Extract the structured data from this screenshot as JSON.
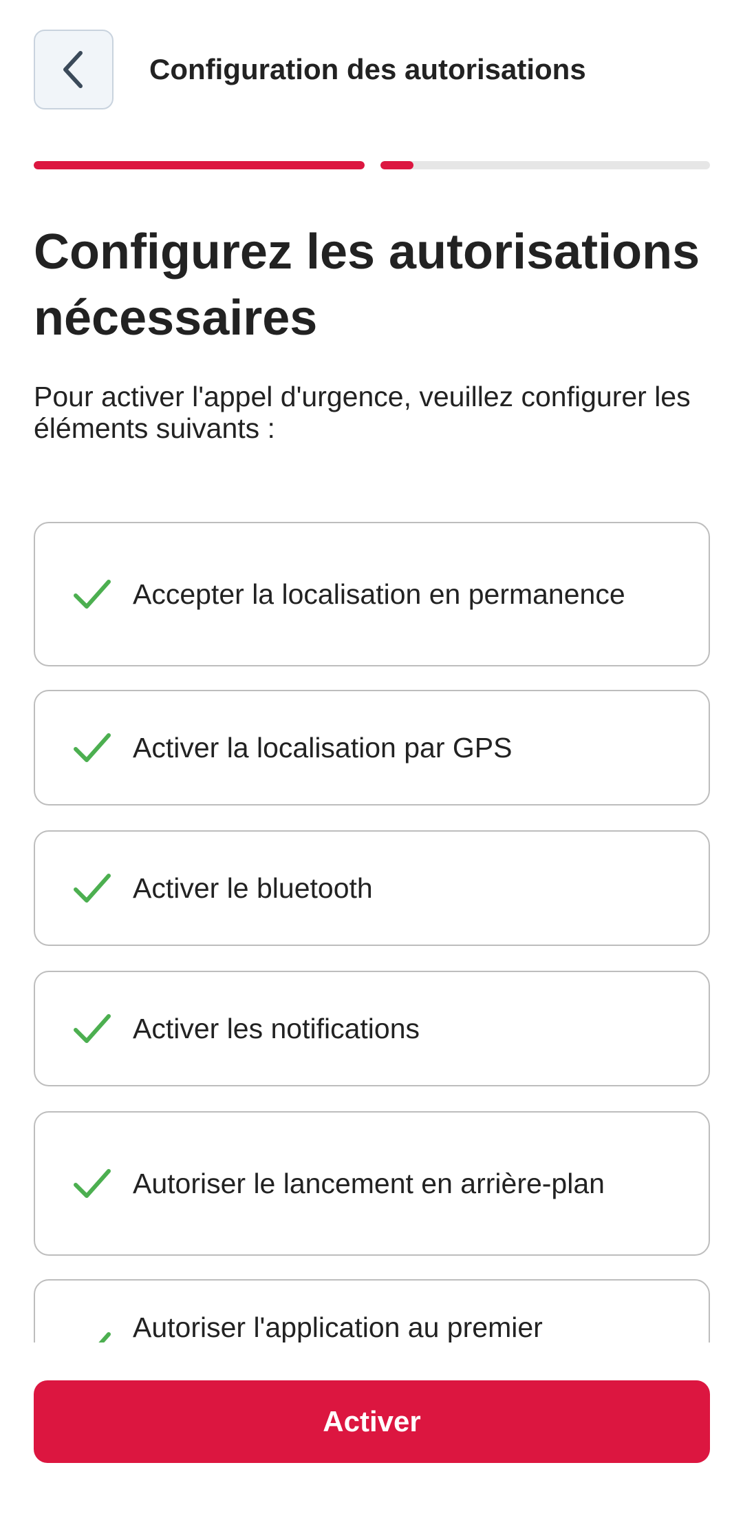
{
  "header": {
    "title": "Configuration des autorisations",
    "back_icon": "chevron-left-icon"
  },
  "progress": {
    "steps": [
      {
        "fraction": 1.0
      },
      {
        "fraction": 0.1
      }
    ],
    "color_active": "#dc1640",
    "color_track": "#e6e6e6"
  },
  "main": {
    "title": "Configurez les autorisations nécessaires",
    "subtitle": "Pour activer l'appel d'urgence, veuillez configurer les éléments suivants :"
  },
  "permissions": {
    "check_icon": "checkmark-icon",
    "check_color": "#4caf50",
    "items": [
      {
        "label": "Accepter la localisation en permanence",
        "done": true
      },
      {
        "label": "Activer la localisation par GPS",
        "done": true
      },
      {
        "label": "Activer le bluetooth",
        "done": true
      },
      {
        "label": "Activer les notifications",
        "done": true
      },
      {
        "label": "Autoriser le lancement en arrière-plan",
        "done": true
      },
      {
        "label": "Autoriser l'application au premier",
        "done": true
      }
    ]
  },
  "cta": {
    "label": "Activer",
    "color": "#dc1640"
  }
}
